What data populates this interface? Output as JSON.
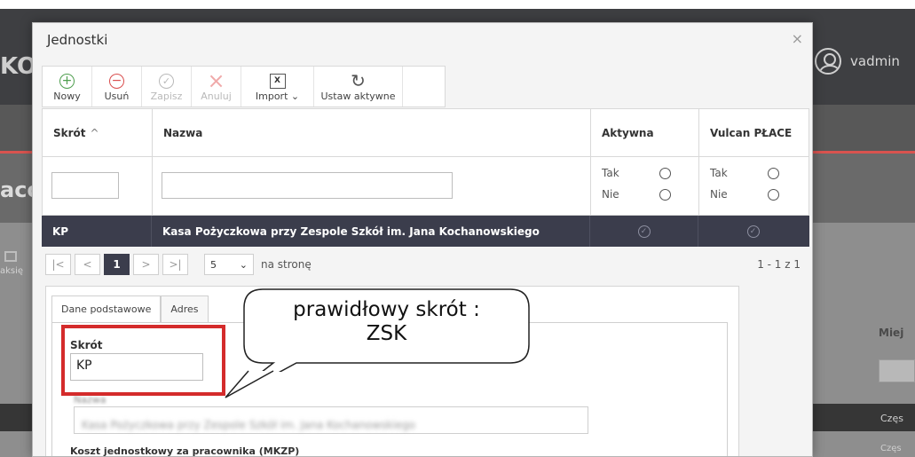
{
  "background": {
    "logo_fragment": "KO",
    "user_name": "vadmin",
    "page_title_fragment": "aco",
    "toolbar_fragment": "aksię",
    "right_column_header": "Miej",
    "right_cell_1": "Częs",
    "right_cell_2": "Częs"
  },
  "dialog": {
    "title": "Jednostki",
    "close_glyph": "×",
    "toolbar": {
      "new": "Nowy",
      "delete": "Usuń",
      "save": "Zapisz",
      "cancel": "Anuluj",
      "import": "Import",
      "set_active": "Ustaw aktywne"
    },
    "grid": {
      "columns": [
        "Skrót",
        "Nazwa",
        "Aktywna",
        "Vulcan PŁACE"
      ],
      "sort_indicator": "^",
      "filter_yes": "Tak",
      "filter_no": "Nie",
      "rows": [
        {
          "code": "KP",
          "name": "Kasa Pożyczkowa przy Zespole Szkół im. Jana Kochanowskiego",
          "active": true,
          "vulcan": true
        }
      ]
    },
    "pager": {
      "first": "|<",
      "prev": "<",
      "current_page": "1",
      "next": ">",
      "last": ">|",
      "page_size": "5",
      "page_size_label": "na stronę",
      "count": "1 - 1 z 1"
    },
    "detail": {
      "tabs": [
        "Dane podstawowe",
        "Adres"
      ],
      "field_code_label": "Skrót",
      "field_code_value": "KP",
      "field_name_label": "Nazwa",
      "field_name_value": "Kasa Pożyczkowa przy Zespole Szkół im. Jana Kochanowskiego",
      "cost_label": "Koszt jednostkowy za pracownika (MKZP)"
    }
  },
  "annotation": {
    "callout_line1": "prawidłowy skrót :",
    "callout_line2": "ZSK",
    "highlight_color": "#d42b2b"
  }
}
